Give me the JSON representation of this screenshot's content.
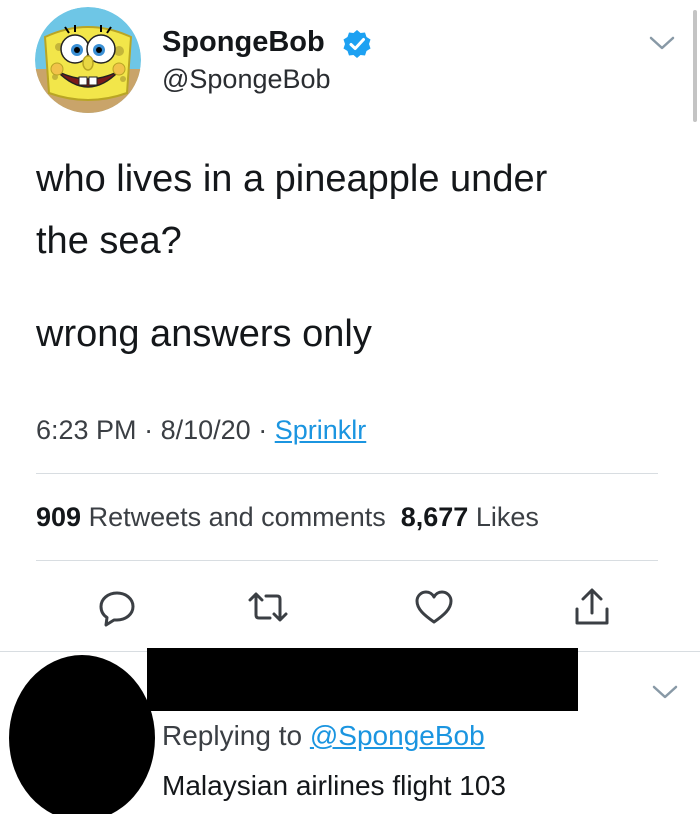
{
  "tweet": {
    "author": {
      "name": "SpongeBob",
      "handle": "@SpongeBob",
      "verified": true,
      "avatar_icon": "spongebob-avatar"
    },
    "text_lines": [
      "who lives in a pineapple under",
      "the sea?",
      "wrong answers only"
    ],
    "meta": {
      "time": "6:23 PM",
      "separator": "·",
      "date": "8/10/20",
      "source": "Sprinklr"
    },
    "stats": {
      "retweets_count": "909",
      "retweets_label": "Retweets and comments",
      "likes_count": "8,677",
      "likes_label": "Likes"
    },
    "actions": [
      {
        "icon": "reply-icon"
      },
      {
        "icon": "retweet-icon"
      },
      {
        "icon": "like-icon"
      },
      {
        "icon": "share-icon"
      }
    ]
  },
  "reply": {
    "context_prefix": "Replying to",
    "context_mention": "@SpongeBob",
    "text": "Malaysian airlines flight 103"
  },
  "colors": {
    "link": "#1b95e0",
    "verified": "#1da1f2",
    "text_primary": "#14171a",
    "text_secondary": "#3b3f44",
    "divider": "#d8dde1",
    "redaction": "#000000"
  }
}
